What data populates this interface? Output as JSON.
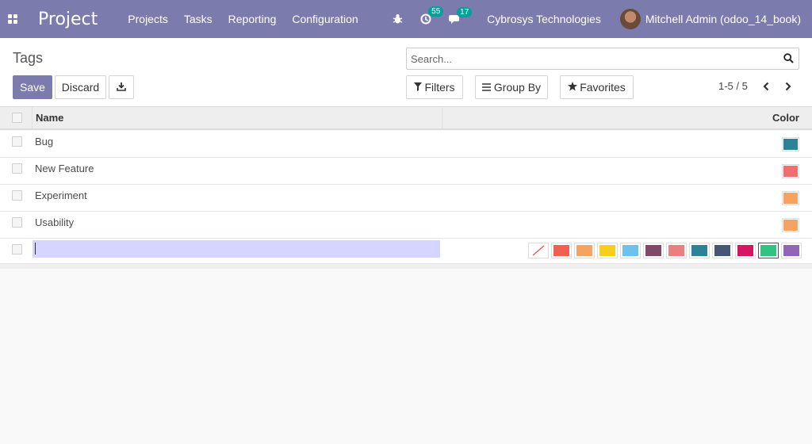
{
  "navbar": {
    "app_title": "Project",
    "menu": [
      "Projects",
      "Tasks",
      "Reporting",
      "Configuration"
    ],
    "activity_count": "55",
    "message_count": "17",
    "company": "Cybrosys Technologies",
    "user": "Mitchell Admin (odoo_14_book)"
  },
  "control": {
    "breadcrumb": "Tags",
    "save_label": "Save",
    "discard_label": "Discard",
    "search_placeholder": "Search...",
    "filters_label": "Filters",
    "groupby_label": "Group By",
    "favorites_label": "Favorites",
    "pager": "1-5 / 5"
  },
  "table": {
    "columns": [
      "Name",
      "Color"
    ],
    "rows": [
      {
        "name": "Bug",
        "color": "#2c8397"
      },
      {
        "name": "New Feature",
        "color": "#f06e6e"
      },
      {
        "name": "Experiment",
        "color": "#f4a460"
      },
      {
        "name": "Usability",
        "color": "#f4a460"
      }
    ],
    "edit_value": ""
  },
  "colors": {
    "brand": "#7c7bad",
    "badge": "#00a09d",
    "picker": [
      "none",
      "#f06050",
      "#f4a460",
      "#f7cd1f",
      "#6cc1ed",
      "#814968",
      "#eb7e7f",
      "#2c8397",
      "#475577",
      "#d6145f",
      "#30c381",
      "#9365b8"
    ],
    "picker_selected": 10
  }
}
